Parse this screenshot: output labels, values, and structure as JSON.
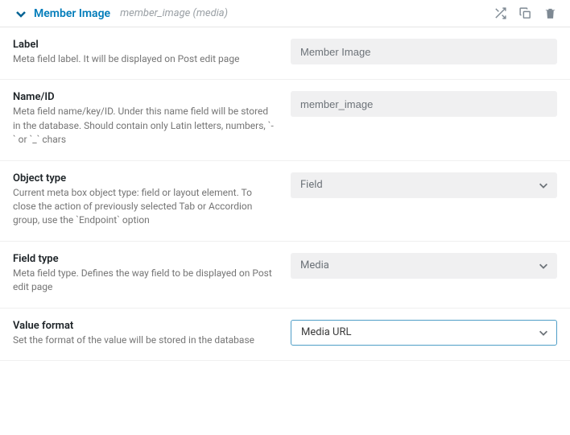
{
  "header": {
    "title": "Member Image",
    "subtitle": "member_image (media)"
  },
  "fields": {
    "label": {
      "title": "Label",
      "desc": "Meta field label. It will be displayed on Post edit page",
      "value": "Member Image"
    },
    "name": {
      "title": "Name/ID",
      "desc": "Meta field name/key/ID. Under this name field will be stored in the database. Should contain only Latin letters, numbers, `-` or `_` chars",
      "value": "member_image"
    },
    "object_type": {
      "title": "Object type",
      "desc": "Current meta box object type: field or layout element. To close the action of previously selected Tab or Accordion group, use the `Endpoint` option",
      "value": "Field"
    },
    "field_type": {
      "title": "Field type",
      "desc": "Meta field type. Defines the way field to be displayed on Post edit page",
      "value": "Media"
    },
    "value_format": {
      "title": "Value format",
      "desc": "Set the format of the value will be stored in the database",
      "value": "Media URL"
    }
  }
}
